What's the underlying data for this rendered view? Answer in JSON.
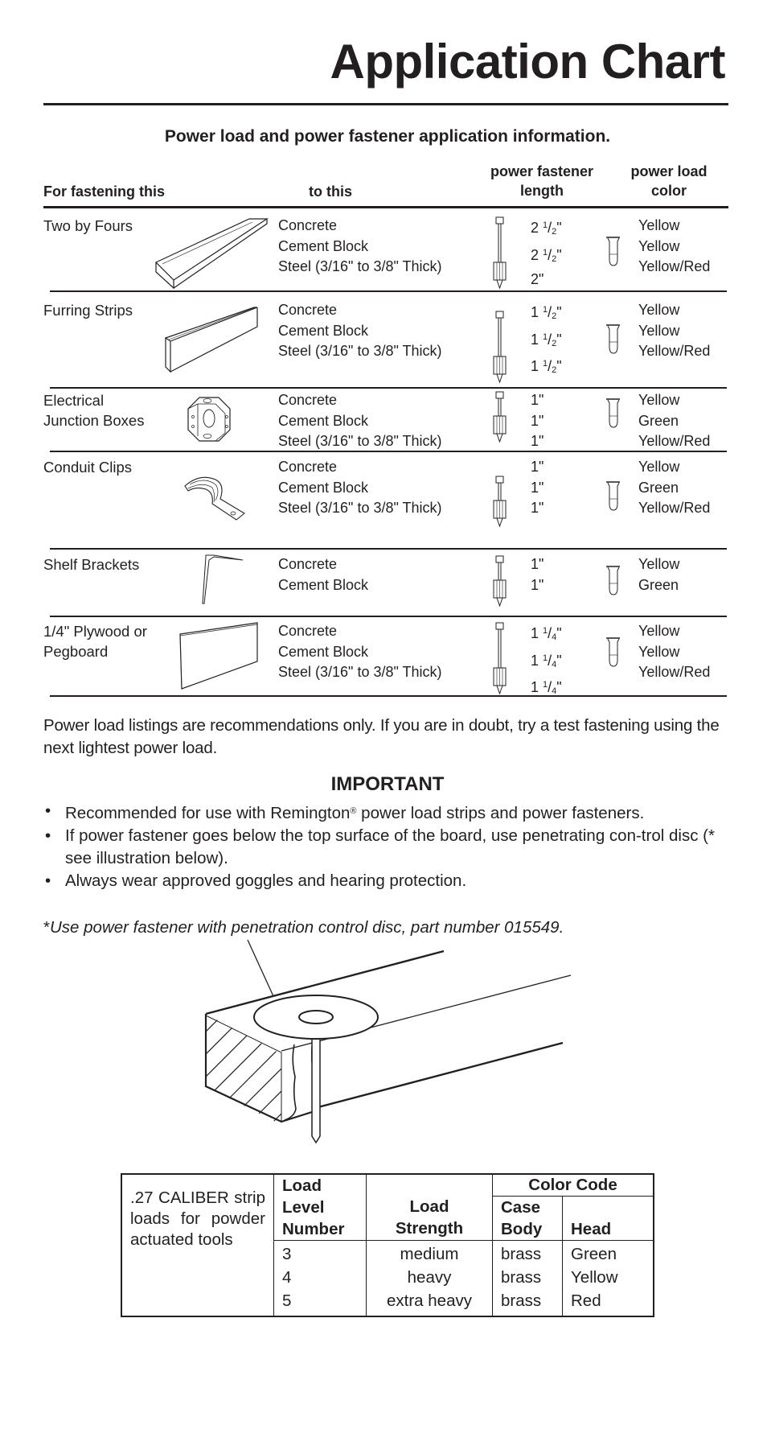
{
  "title": "Application Chart",
  "subtitle": "Power load and power fastener application information.",
  "columns": {
    "fastening_this": "For fastening this",
    "to_this": "to this",
    "fastener_length": [
      "power fastener",
      "length"
    ],
    "load_color": [
      "power load",
      "color"
    ]
  },
  "rows": [
    {
      "item": [
        "Two by Fours"
      ],
      "icon": "two-by-four-icon",
      "surfaces": [
        "Concrete",
        "Cement Block",
        "Steel (3/16\" to 3/8\" Thick)"
      ],
      "lengths": [
        {
          "whole": "2",
          "num": "1",
          "den": "2"
        },
        {
          "whole": "2",
          "num": "1",
          "den": "2"
        },
        {
          "whole": "2",
          "num": "",
          "den": ""
        }
      ],
      "colors": [
        "Yellow",
        "Yellow",
        "Yellow/Red"
      ]
    },
    {
      "item": [
        "Furring Strips"
      ],
      "icon": "furring-strip-icon",
      "surfaces": [
        "Concrete",
        "Cement Block",
        "Steel (3/16\" to 3/8\" Thick)"
      ],
      "lengths": [
        {
          "whole": "1",
          "num": "1",
          "den": "2"
        },
        {
          "whole": "1",
          "num": "1",
          "den": "2"
        },
        {
          "whole": "1",
          "num": "1",
          "den": "2"
        }
      ],
      "colors": [
        "Yellow",
        "Yellow",
        "Yellow/Red"
      ]
    },
    {
      "item": [
        "Electrical",
        "Junction Boxes"
      ],
      "icon": "junction-box-icon",
      "surfaces": [
        "Concrete",
        "Cement Block",
        "Steel (3/16\" to 3/8\" Thick)"
      ],
      "lengths": [
        {
          "whole": "1",
          "num": "",
          "den": ""
        },
        {
          "whole": "1",
          "num": "",
          "den": ""
        },
        {
          "whole": "1",
          "num": "",
          "den": ""
        }
      ],
      "colors": [
        "Yellow",
        "Green",
        "Yellow/Red"
      ]
    },
    {
      "item": [
        "Conduit Clips"
      ],
      "icon": "conduit-clip-icon",
      "surfaces": [
        "Concrete",
        "Cement Block",
        "Steel (3/16\" to 3/8\" Thick)"
      ],
      "lengths": [
        {
          "whole": "1",
          "num": "",
          "den": ""
        },
        {
          "whole": "1",
          "num": "",
          "den": ""
        },
        {
          "whole": "1",
          "num": "",
          "den": ""
        }
      ],
      "colors": [
        "Yellow",
        "Green",
        "Yellow/Red"
      ]
    },
    {
      "item": [
        "Shelf Brackets"
      ],
      "icon": "shelf-bracket-icon",
      "surfaces": [
        "Concrete",
        "Cement Block"
      ],
      "lengths": [
        {
          "whole": "1",
          "num": "",
          "den": ""
        },
        {
          "whole": "1",
          "num": "",
          "den": ""
        }
      ],
      "colors": [
        "Yellow",
        "Green"
      ]
    },
    {
      "item": [
        "1/4\" Plywood or",
        "Pegboard"
      ],
      "icon": "plywood-panel-icon",
      "surfaces": [
        "Concrete",
        "Cement Block",
        "Steel (3/16\" to 3/8\" Thick)"
      ],
      "lengths": [
        {
          "whole": "1",
          "num": "1",
          "den": "4"
        },
        {
          "whole": "1",
          "num": "1",
          "den": "4"
        },
        {
          "whole": "1",
          "num": "1",
          "den": "4"
        }
      ],
      "colors": [
        "Yellow",
        "Yellow",
        "Yellow/Red"
      ]
    }
  ],
  "note": "Power load listings are recommendations only. If you are in doubt, try a test fastening using the next lightest power load.",
  "important": {
    "heading": "IMPORTANT",
    "bullets": [
      {
        "before": "Recommended for use with Remington",
        "mark": "®",
        "after": " power load strips and power fasteners."
      },
      {
        "before": "If power fastener goes below the top surface of the board, use penetrating con-trol disc (* see illustration below).",
        "mark": "",
        "after": ""
      },
      {
        "before": "Always wear approved goggles and hearing protection.",
        "mark": "",
        "after": ""
      }
    ]
  },
  "footnote": {
    "asterisk": "*",
    "text": "Use power fastener with penetration control disc, part number 015549."
  },
  "illustration": "penetration-control-disc-illustration",
  "caliber_table": {
    "description": ".27 CALIBER strip loads for powder actuated tools",
    "headers": {
      "load_level_number": [
        "Load",
        "Level",
        "Number"
      ],
      "load_strength": [
        "Load",
        "Strength"
      ],
      "color_code": "Color Code",
      "case_body": [
        "Case",
        "Body"
      ],
      "head": "Head"
    },
    "rows": [
      {
        "level": "3",
        "strength": "medium",
        "case_body": "brass",
        "head": "Green"
      },
      {
        "level": "4",
        "strength": "heavy",
        "case_body": "brass",
        "head": "Yellow"
      },
      {
        "level": "5",
        "strength": "extra heavy",
        "case_body": "brass",
        "head": "Red"
      }
    ]
  }
}
